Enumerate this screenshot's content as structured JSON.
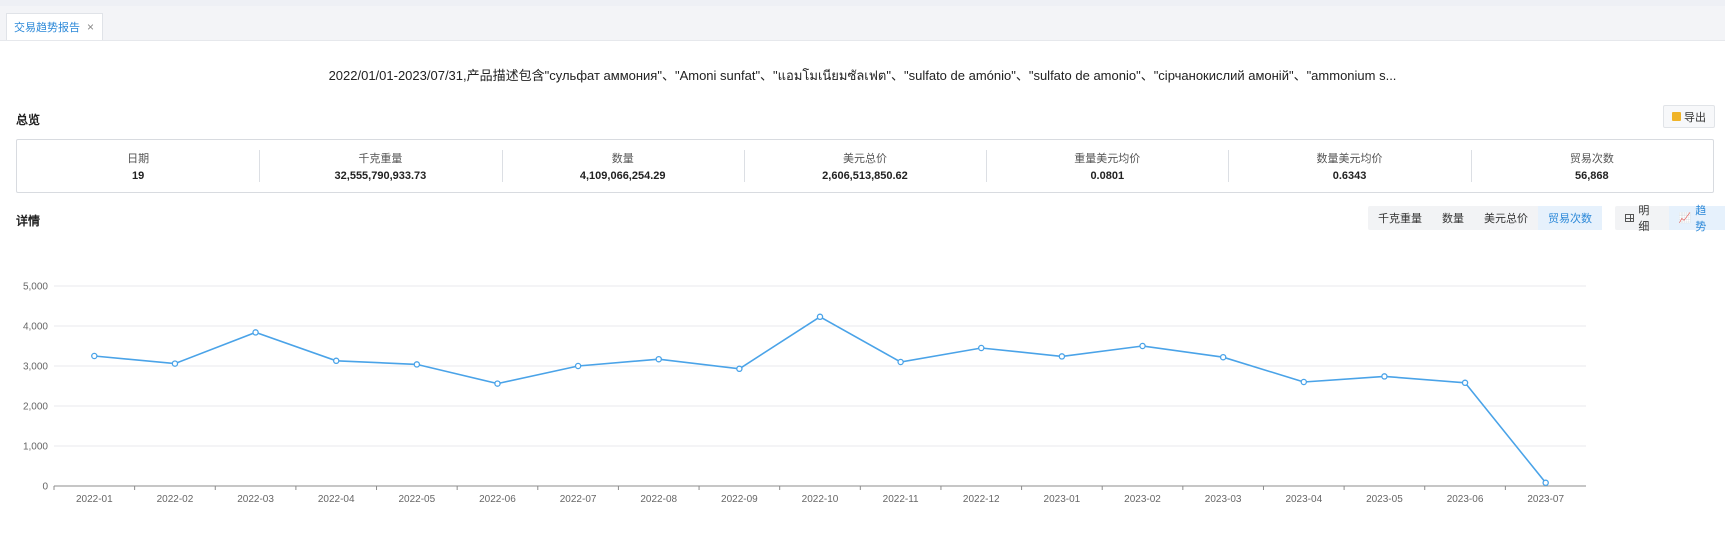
{
  "tab": {
    "label": "交易趋势报告",
    "close_glyph": "×"
  },
  "report_title": "2022/01/01-2023/07/31,产品描述包含\"сульфат аммония\"、\"Amoni sunfat\"、\"แอมโมเนียมซัลเฟต\"、\"sulfato de amónio\"、\"sulfato de amonio\"、\"сірчанокислий амоній\"、\"ammonium s...",
  "overview": {
    "title": "总览",
    "export_label": "导出",
    "metrics": [
      {
        "label": "日期",
        "value": "19"
      },
      {
        "label": "千克重量",
        "value": "32,555,790,933.73"
      },
      {
        "label": "数量",
        "value": "4,109,066,254.29"
      },
      {
        "label": "美元总价",
        "value": "2,606,513,850.62"
      },
      {
        "label": "重量美元均价",
        "value": "0.0801"
      },
      {
        "label": "数量美元均价",
        "value": "0.6343"
      },
      {
        "label": "贸易次数",
        "value": "56,868"
      }
    ]
  },
  "details": {
    "title": "详情",
    "metric_buttons": [
      "千克重量",
      "数量",
      "美元总价",
      "贸易次数"
    ],
    "active_metric": "贸易次数",
    "view_buttons": [
      "明细",
      "趋势"
    ],
    "active_view": "趋势"
  },
  "colors": {
    "accent": "#2b88d8",
    "line": "#4aa3e8"
  },
  "chart_data": {
    "type": "line",
    "categories": [
      "2022-01",
      "2022-02",
      "2022-03",
      "2022-04",
      "2022-05",
      "2022-06",
      "2022-07",
      "2022-08",
      "2022-09",
      "2022-10",
      "2022-11",
      "2022-12",
      "2023-01",
      "2023-02",
      "2023-03",
      "2023-04",
      "2023-05",
      "2023-06",
      "2023-07"
    ],
    "series": [
      {
        "values": [
          3250,
          3060,
          3840,
          3130,
          3040,
          2560,
          3000,
          3170,
          2930,
          4230,
          3100,
          3450,
          3240,
          3500,
          3220,
          2600,
          2740,
          2580,
          80
        ]
      }
    ],
    "yticks": [
      "0",
      "1,000",
      "2,000",
      "3,000",
      "4,000",
      "5,000"
    ],
    "ylim": [
      0,
      5000
    ],
    "grid": true,
    "legend": "none"
  }
}
